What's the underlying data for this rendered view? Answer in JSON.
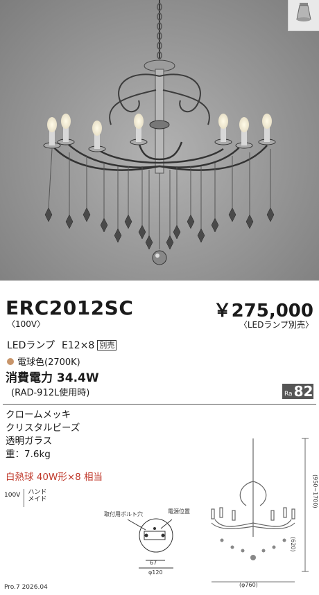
{
  "product": {
    "model": "ERC2012SC",
    "voltage": "〈100V〉",
    "price": "￥275,000",
    "price_note": "〈LEDランプ別売〉",
    "lamp_label": "LEDランプ",
    "lamp_spec": "E12×8",
    "lamp_badge": "別売",
    "light_color": "電球色(2700K)",
    "light_dot_color": "#c8956a",
    "power": "消費電力 34.4W",
    "power_note": "(RAD-912L使用時)",
    "ra_label": "Ra",
    "ra_value": "82"
  },
  "specs": {
    "finish": "クロームメッキ",
    "beads": "クリスタルビーズ",
    "glass": "透明ガラス",
    "weight": "重：7.6kg",
    "equivalent": "白熱球 40W形×8 相当",
    "equivalent_color": "#c0392b"
  },
  "tags": {
    "voltage": "100V",
    "handmade_1": "ハンド",
    "handmade_2": "メイド"
  },
  "drawing": {
    "bolt_hole": "取付用ボルト穴",
    "power_pos": "電源位置",
    "dim_67": "67",
    "dim_120": "φ120",
    "dim_760": "(φ760)",
    "dim_height": "(950~1700)",
    "dim_620": "(620)"
  },
  "footer": {
    "code": "Pro.7 2026.04"
  }
}
